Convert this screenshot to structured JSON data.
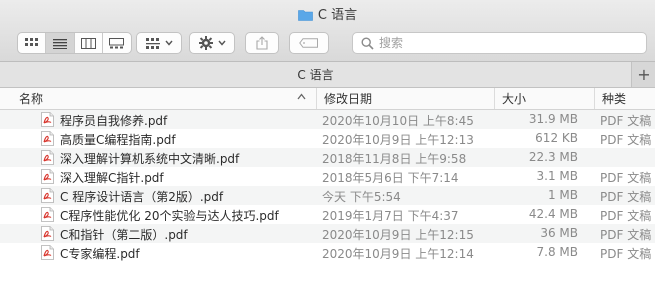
{
  "window": {
    "title": "C 语言"
  },
  "toolbar": {
    "view_modes": [
      "icon-view",
      "list-view",
      "column-view",
      "gallery-view"
    ],
    "active_view": "list-view",
    "search_placeholder": "搜索"
  },
  "tabbar": {
    "tab_label": "C 语言",
    "add_label": "+"
  },
  "columns": {
    "name": "名称",
    "date": "修改日期",
    "size": "大小",
    "kind": "种类"
  },
  "files": [
    {
      "name": "程序员自我修养.pdf",
      "date": "2020年10月10日 上午8:45",
      "size": "31.9 MB",
      "kind": "PDF 文稿"
    },
    {
      "name": "高质量C编程指南.pdf",
      "date": "2020年10月9日 上午12:13",
      "size": "612 KB",
      "kind": "PDF 文稿"
    },
    {
      "name": "深入理解计算机系统中文清晰.pdf",
      "date": "2018年11月8日 上午9:58",
      "size": "22.3 MB",
      "kind": ""
    },
    {
      "name": "深入理解C指针.pdf",
      "date": "2018年5月6日 下午7:14",
      "size": "3.1 MB",
      "kind": "PDF 文稿"
    },
    {
      "name": "C 程序设计语言（第2版）.pdf",
      "date": "今天 下午5:54",
      "size": "1 MB",
      "kind": "PDF 文稿"
    },
    {
      "name": "C程序性能优化  20个实验与达人技巧.pdf",
      "date": "2019年1月7日 下午4:37",
      "size": "42.4 MB",
      "kind": "PDF 文稿"
    },
    {
      "name": "C和指针（第二版）.pdf",
      "date": "2020年10月9日 上午12:15",
      "size": "36 MB",
      "kind": "PDF 文稿"
    },
    {
      "name": "C专家编程.pdf",
      "date": "2020年10月9日 上午12:14",
      "size": "7.8 MB",
      "kind": "PDF 文稿"
    }
  ],
  "colors": {
    "folder": "#5aa7e8",
    "pdf_icon": "#d8342c"
  }
}
